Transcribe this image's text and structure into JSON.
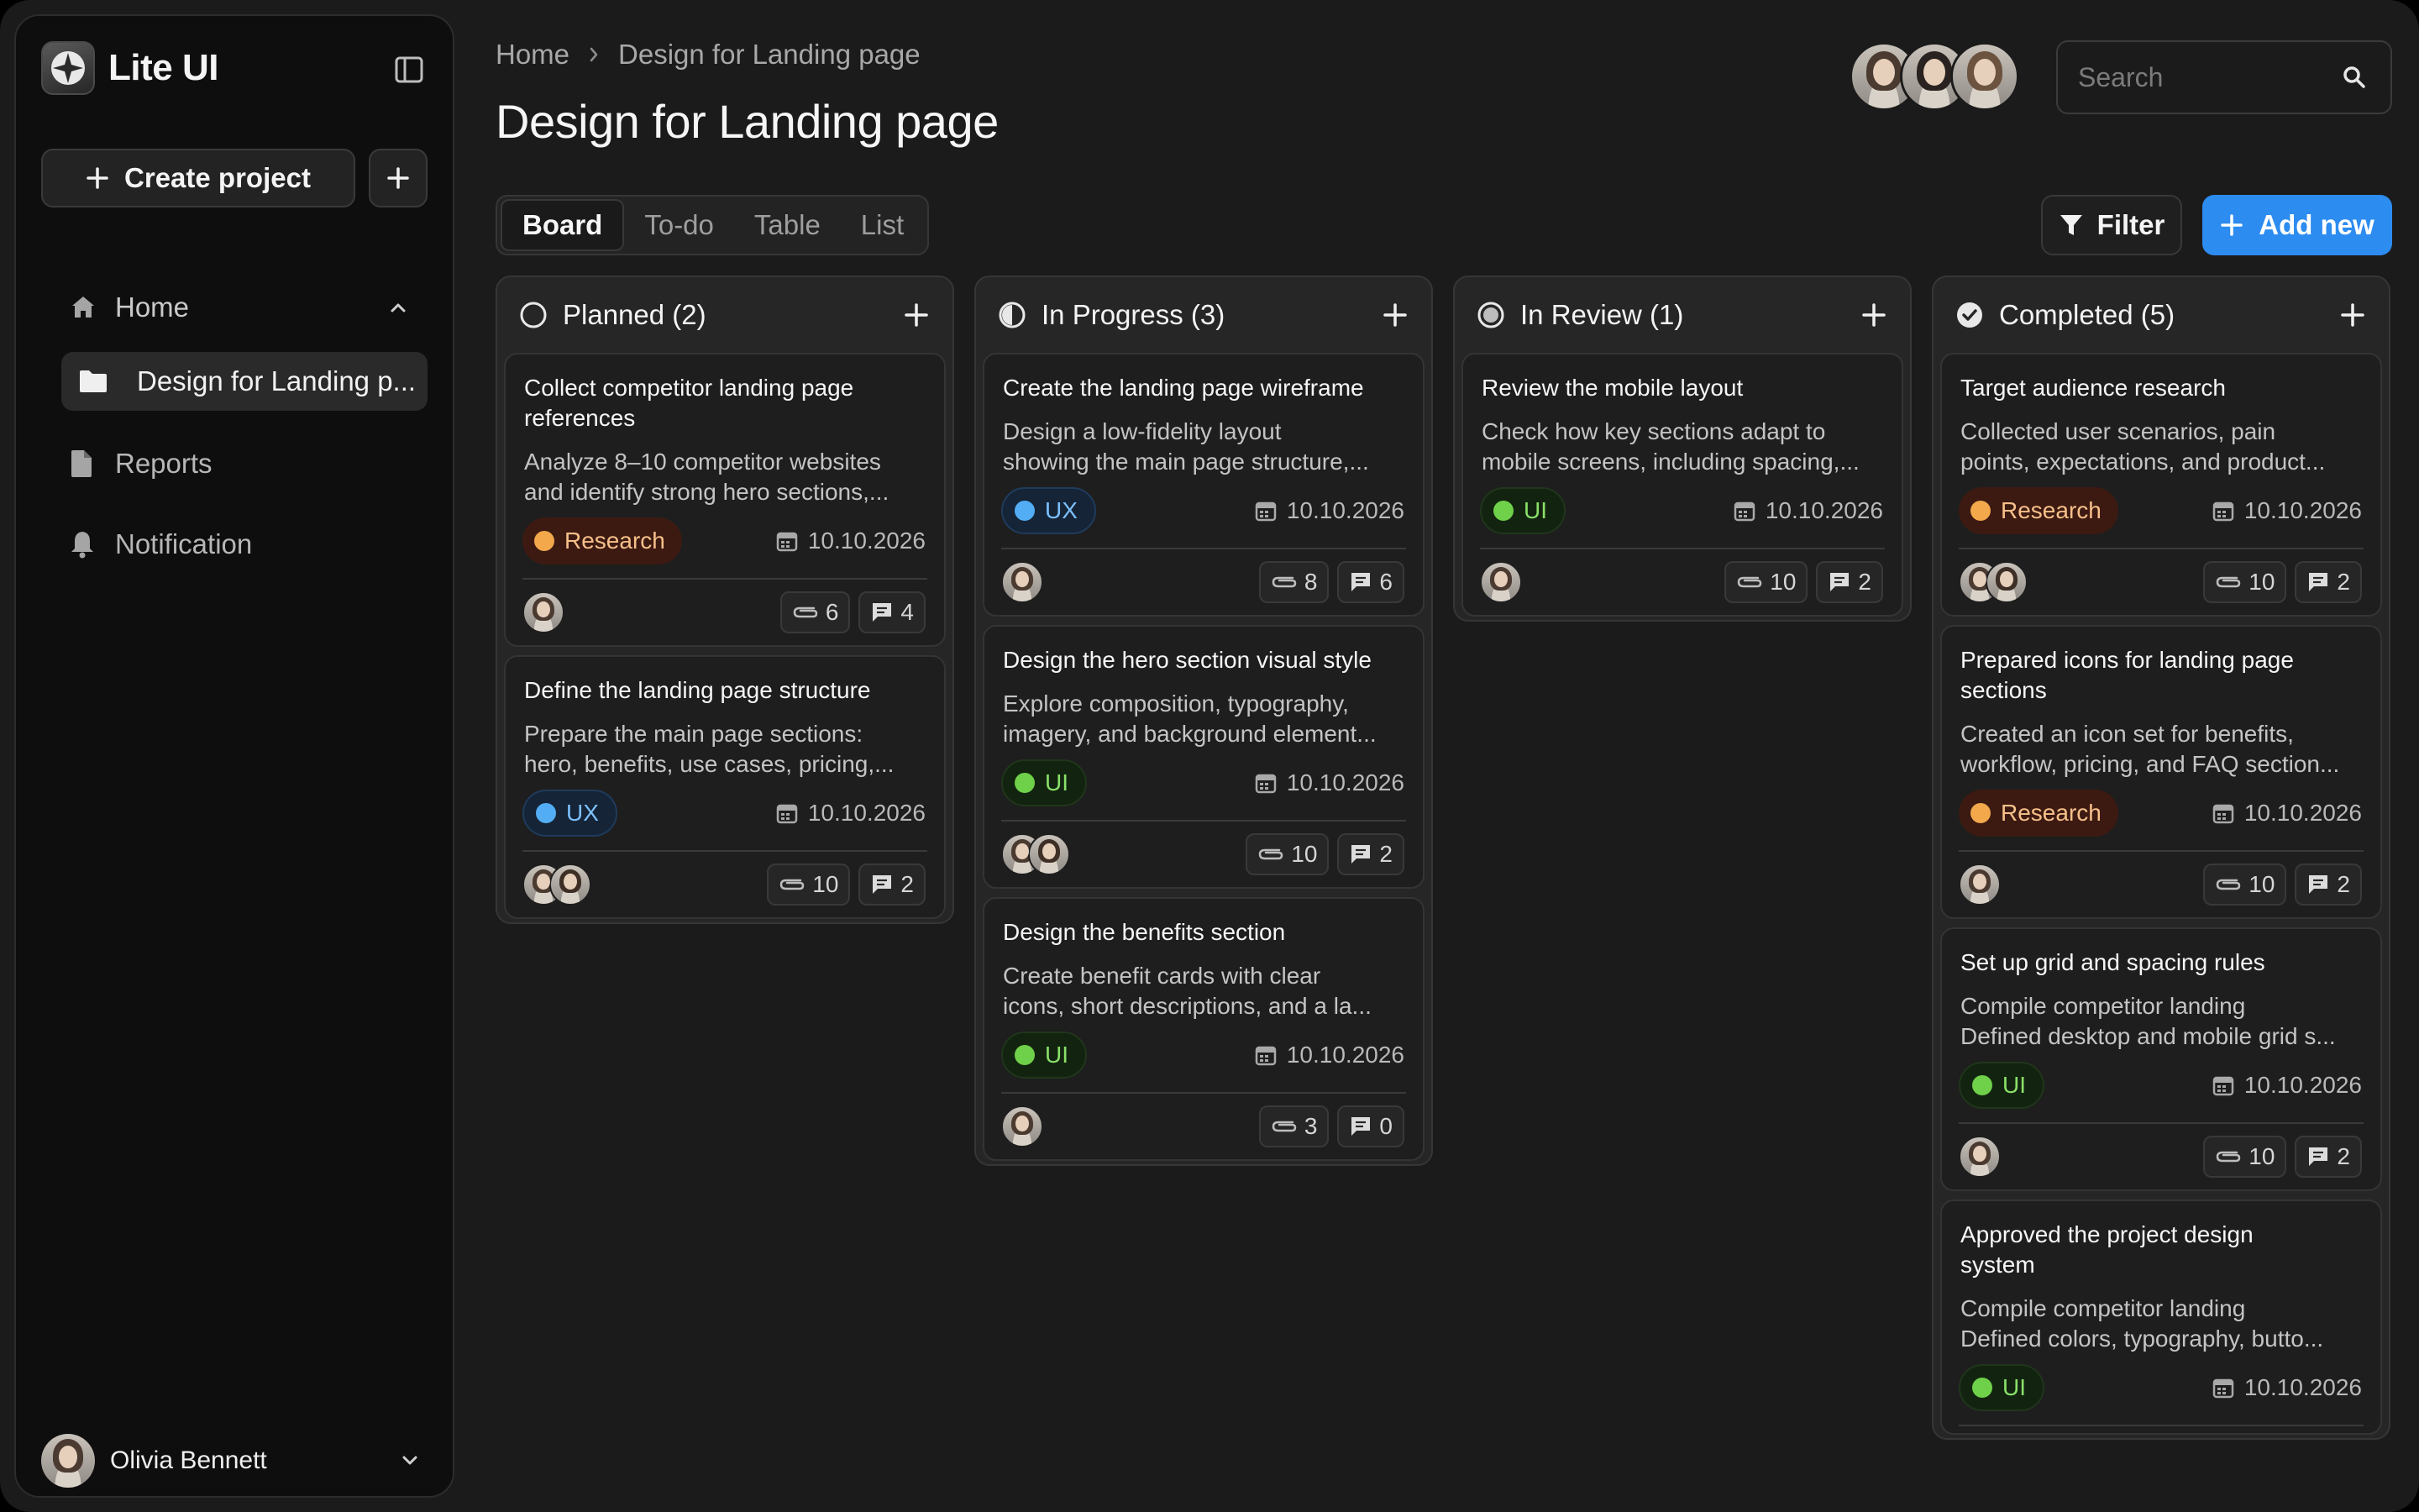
{
  "app": {
    "name": "Lite UI"
  },
  "sidebar": {
    "create_project_label": "Create project",
    "nav": {
      "home": "Home",
      "current_project": "Design for Landing p...",
      "reports": "Reports",
      "notification": "Notification"
    },
    "user_name": "Olivia Bennett"
  },
  "header": {
    "breadcrumb": [
      "Home",
      "Design for Landing page"
    ],
    "title": "Design for Landing page",
    "search_placeholder": "Search"
  },
  "tabs": [
    "Board",
    "To-do",
    "Table",
    "List"
  ],
  "active_tab": "Board",
  "toolbar": {
    "filter_label": "Filter",
    "add_new_label": "Add new"
  },
  "colors": {
    "accent": "#2d8cf0",
    "research": "#f2a84b",
    "ux": "#53adf5",
    "ui": "#6fd04a"
  },
  "columns": [
    {
      "title": "Planned (2)",
      "status_icon": "circle-empty-icon",
      "cards": [
        {
          "title_lines": [
            "Collect competitor landing page",
            "references"
          ],
          "desc_lines": [
            "Analyze 8–10 competitor websites",
            "and identify strong hero sections,..."
          ],
          "tag": "Research",
          "date": "10.10.2026",
          "attachments": "6",
          "comments": "4",
          "avatars": 1
        },
        {
          "title_lines": [
            "Define the landing page structure"
          ],
          "desc_lines": [
            "Prepare the main page sections:",
            "hero, benefits, use cases, pricing,..."
          ],
          "tag": "UX",
          "date": "10.10.2026",
          "attachments": "10",
          "comments": "2",
          "avatars": 2
        }
      ]
    },
    {
      "title": "In Progress (3)",
      "status_icon": "circle-half-icon",
      "cards": [
        {
          "title_lines": [
            "Create the landing page wireframe"
          ],
          "desc_lines": [
            "Design a low-fidelity layout",
            "showing the main page structure,..."
          ],
          "tag": "UX",
          "date": "10.10.2026",
          "attachments": "8",
          "comments": "6",
          "avatars": 1
        },
        {
          "title_lines": [
            "Design the hero section visual style"
          ],
          "desc_lines": [
            "Explore composition, typography,",
            "imagery, and background element..."
          ],
          "tag": "UI",
          "date": "10.10.2026",
          "attachments": "10",
          "comments": "2",
          "avatars": 2
        },
        {
          "title_lines": [
            "Design the benefits section"
          ],
          "desc_lines": [
            "Create benefit cards with clear",
            "icons, short descriptions, and a la..."
          ],
          "tag": "UI",
          "date": "10.10.2026",
          "attachments": "3",
          "comments": "0",
          "avatars": 1
        }
      ]
    },
    {
      "title": "In Review (1)",
      "status_icon": "circle-filled-icon",
      "cards": [
        {
          "title_lines": [
            "Review the mobile layout"
          ],
          "desc_lines": [
            "Check how key sections adapt to",
            "mobile screens, including spacing,..."
          ],
          "tag": "UI",
          "date": "10.10.2026",
          "attachments": "10",
          "comments": "2",
          "avatars": 1
        }
      ]
    },
    {
      "title": "Completed (5)",
      "status_icon": "check-circle-icon",
      "cards": [
        {
          "title_lines": [
            "Target audience research"
          ],
          "desc_lines": [
            "Collected user scenarios, pain",
            "points, expectations, and product..."
          ],
          "tag": "Research",
          "date": "10.10.2026",
          "attachments": "10",
          "comments": "2",
          "avatars": 2
        },
        {
          "title_lines": [
            "Prepared icons for landing page",
            "sections"
          ],
          "desc_lines": [
            "Created an icon set for benefits,",
            "workflow, pricing, and FAQ section..."
          ],
          "tag": "Research",
          "date": "10.10.2026",
          "attachments": "10",
          "comments": "2",
          "avatars": 1
        },
        {
          "title_lines": [
            "Set up grid and spacing rules"
          ],
          "desc_lines": [
            "Compile competitor landing",
            "Defined desktop and mobile grid s..."
          ],
          "tag": "UI",
          "date": "10.10.2026",
          "attachments": "10",
          "comments": "2",
          "avatars": 1
        },
        {
          "title_lines": [
            "Approved the project design",
            "system"
          ],
          "desc_lines": [
            "Compile competitor landing",
            "Defined colors, typography, butto..."
          ],
          "tag": "UI",
          "date": "10.10.2026",
          "attachments": "",
          "comments": "",
          "avatars": 0
        }
      ]
    }
  ]
}
